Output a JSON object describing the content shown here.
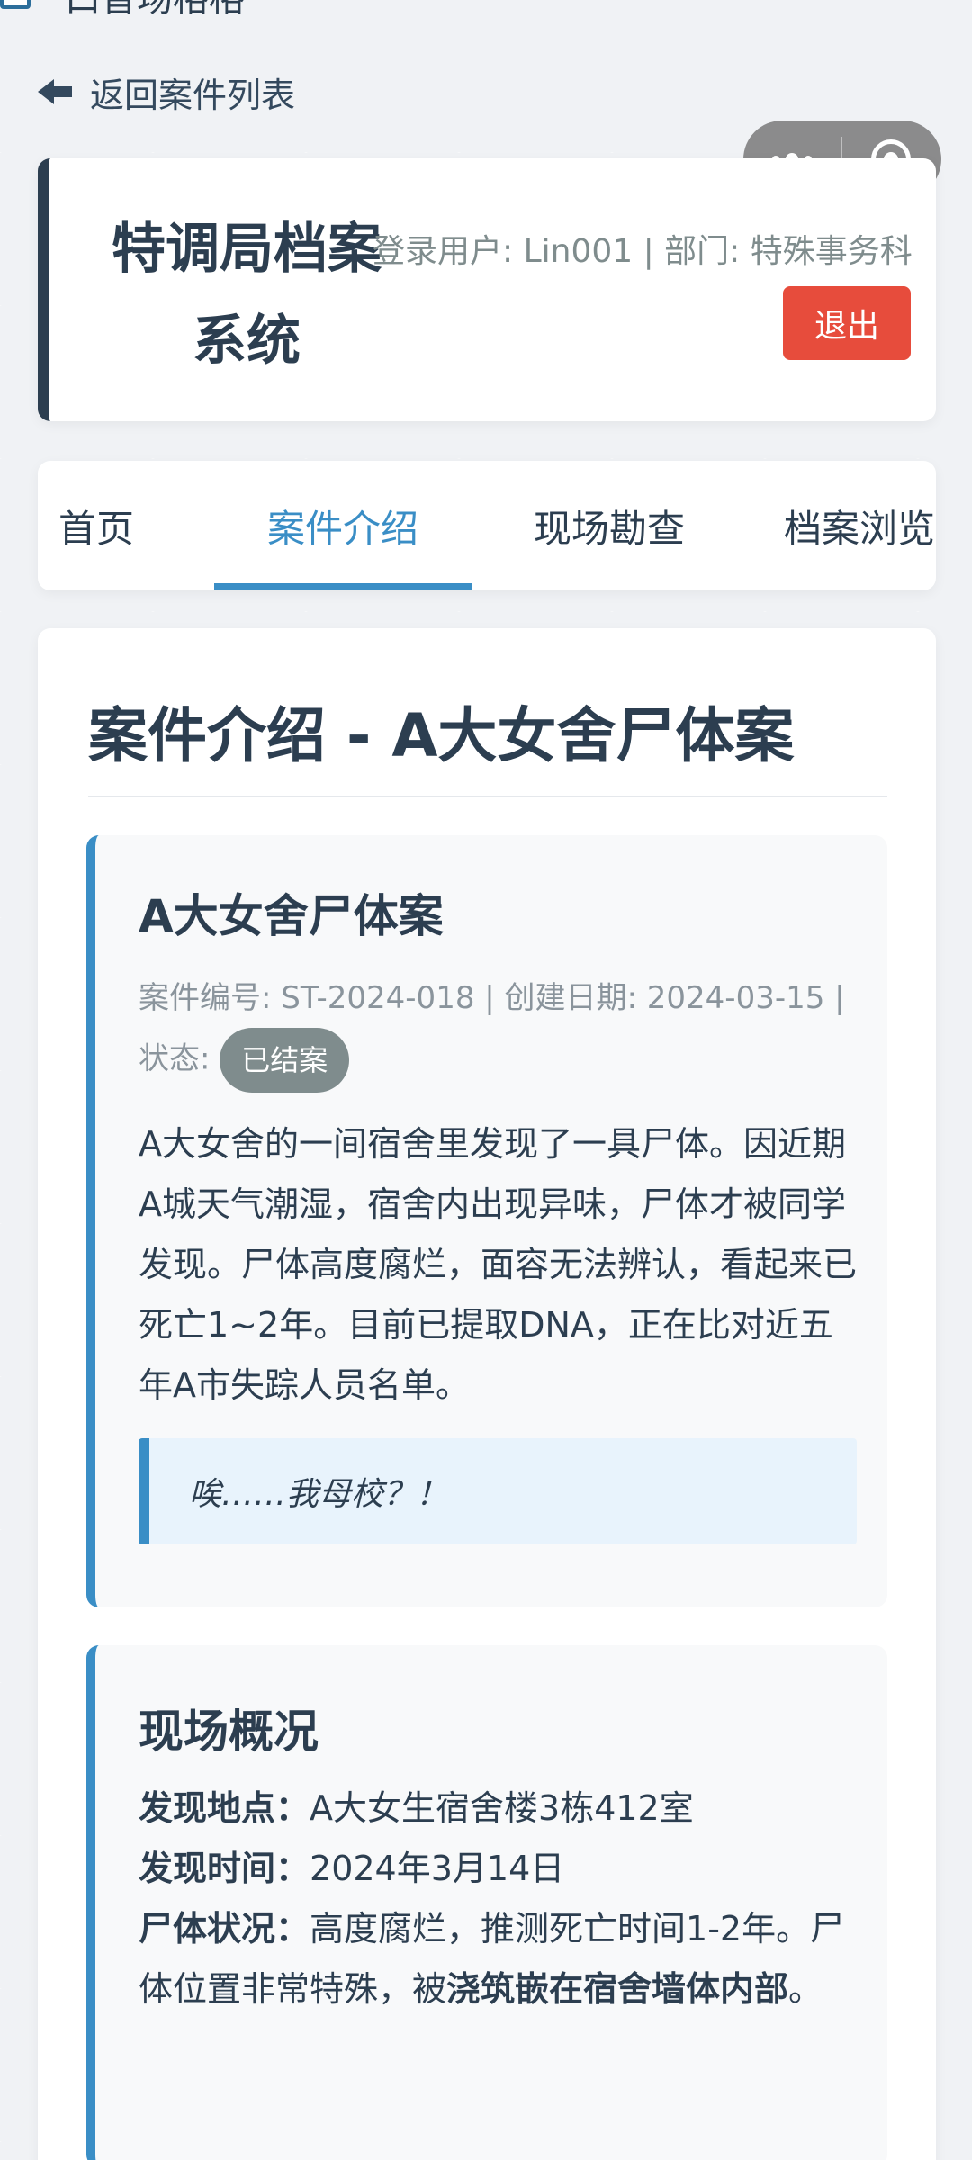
{
  "top": {
    "partial_title": "口普场格格"
  },
  "back": {
    "label": "返回案件列表"
  },
  "header": {
    "system_title": "特调局档案系统",
    "user_info": "登录用户: Lin001 | 部门: 特殊事务科",
    "logout_label": "退出"
  },
  "tabs": [
    {
      "label": "首页"
    },
    {
      "label": "案件介绍"
    },
    {
      "label": "现场勘查"
    },
    {
      "label": "档案浏览"
    }
  ],
  "main": {
    "page_title": "案件介绍 - A大女舍尸体案",
    "case": {
      "title": "A大女舍尸体案",
      "meta_text": "案件编号: ST-2024-018 | 创建日期: 2024-03-15 | 状态: ",
      "status": "已结案",
      "description": "A大女舍的一间宿舍里发现了一具尸体。因近期A城天气潮湿，宿舍内出现异味，尸体才被同学发现。尸体高度腐烂，面容无法辨认，看起来已死亡1~2年。目前已提取DNA，正在比对近五年A市失踪人员名单。",
      "quote": "唉……我母校？！"
    },
    "scene": {
      "title": "现场概况",
      "location_label": "发现地点：",
      "location_value": "A大女生宿舍楼3栋412室",
      "time_label": "发现时间：",
      "time_value": "2024年3月14日",
      "body_label": "尸体状况：",
      "body_value_1": "高度腐烂，推测死亡时间1-2年。尸体位置非常特殊，被",
      "body_value_em": "浇筑嵌在宿舍墙体内部",
      "body_value_2": "。"
    }
  },
  "colors": {
    "accent": "#3a8ec6",
    "dark": "#2c3e50",
    "logout": "#e74c3c",
    "badge": "#7f8c8d"
  },
  "icons": [
    "back-arrow-icon",
    "more-dots-icon",
    "close-target-icon"
  ]
}
